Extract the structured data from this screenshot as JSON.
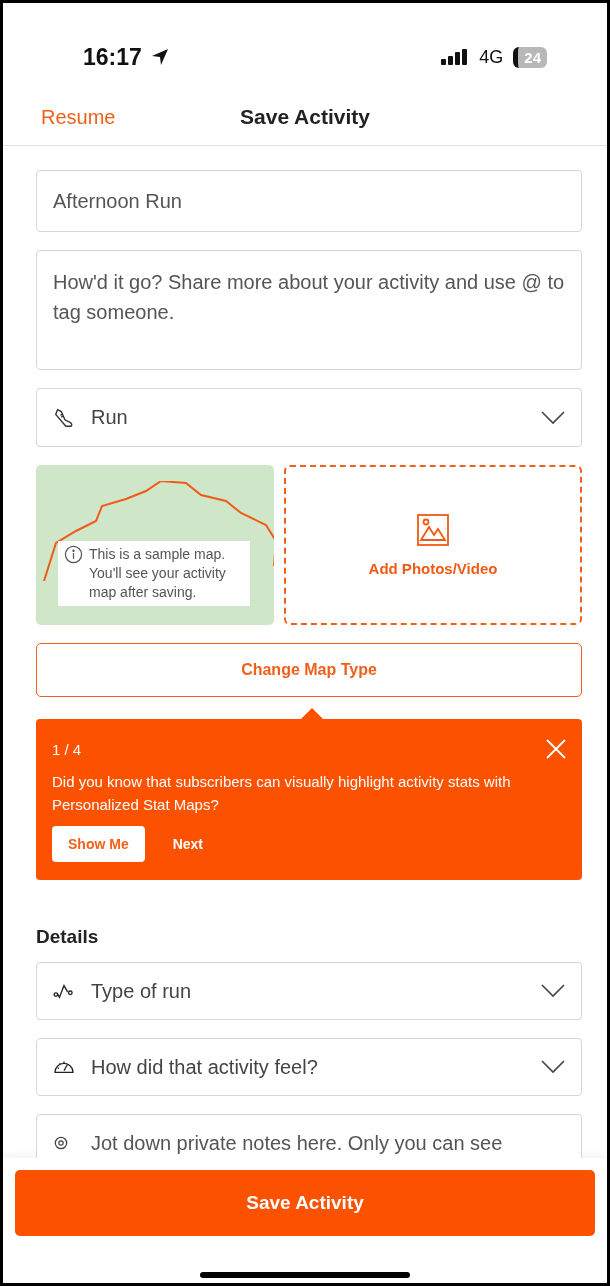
{
  "status_bar": {
    "time": "16:17",
    "network": "4G",
    "battery": "24"
  },
  "nav": {
    "back": "Resume",
    "title": "Save Activity"
  },
  "form": {
    "title_value": "Afternoon Run",
    "description_placeholder": "How'd it go? Share more about your activity and use @ to tag someone.",
    "sport": "Run"
  },
  "media": {
    "map_note": "This is a sample map. You'll see your activity map after saving.",
    "add_media": "Add Photos/Video",
    "change_map_type": "Change Map Type"
  },
  "tip": {
    "step": "1 / 4",
    "text": "Did you know that subscribers can visually highlight activity stats with Personalized Stat Maps?",
    "primary": "Show Me",
    "secondary": "Next"
  },
  "details": {
    "heading": "Details",
    "selects": [
      {
        "kind": "run-type",
        "label": "Type of run"
      },
      {
        "kind": "feel",
        "label": "How did that activity feel?"
      }
    ],
    "notes_placeholder": "Jot down private notes here. Only you can see"
  },
  "save_button": "Save Activity"
}
